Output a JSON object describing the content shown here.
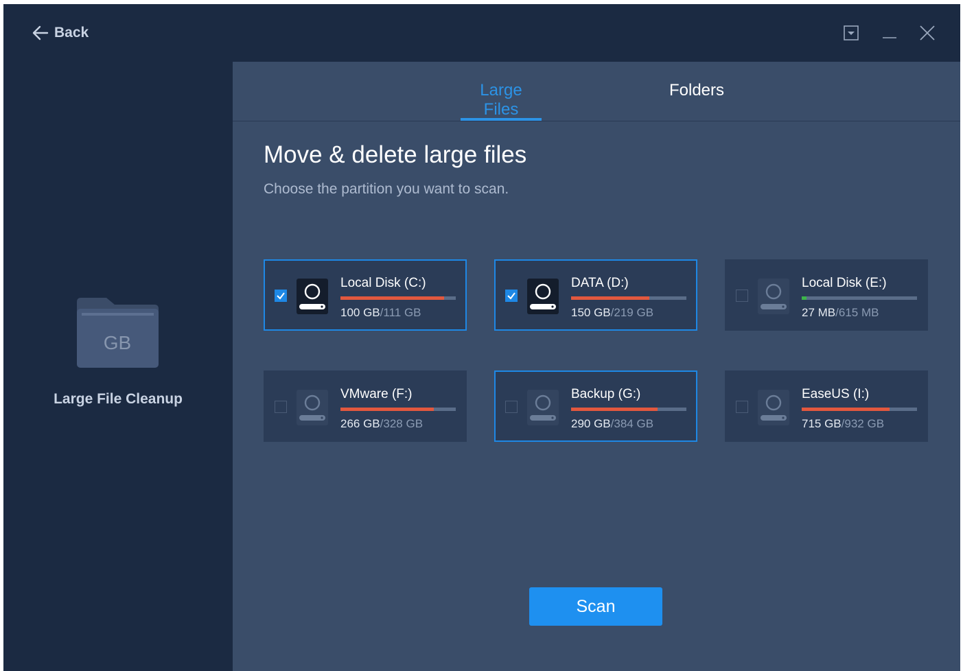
{
  "titlebar": {
    "back_label": "Back"
  },
  "sidebar": {
    "folder_badge": "GB",
    "title": "Large File Cleanup"
  },
  "tabs": [
    {
      "label": "Large Files",
      "active": true
    },
    {
      "label": "Folders",
      "active": false
    }
  ],
  "main": {
    "heading": "Move & delete large files",
    "subheading": "Choose the partition you want to scan."
  },
  "partitions": [
    {
      "name": "Local Disk (C:)",
      "used": "100 GB",
      "total": "/111 GB",
      "usage_fraction": 0.9,
      "checked": true,
      "selected": true,
      "bar_color": "#e2583e"
    },
    {
      "name": "DATA (D:)",
      "used": "150 GB",
      "total": "/219 GB",
      "usage_fraction": 0.68,
      "checked": true,
      "selected": true,
      "bar_color": "#e2583e"
    },
    {
      "name": "Local Disk (E:)",
      "used": "27 MB",
      "total": "/615 MB",
      "usage_fraction": 0.04,
      "checked": false,
      "selected": false,
      "bar_color": "#3cb44b"
    },
    {
      "name": "VMware (F:)",
      "used": "266 GB",
      "total": "/328 GB",
      "usage_fraction": 0.81,
      "checked": false,
      "selected": false,
      "bar_color": "#e2583e"
    },
    {
      "name": "Backup (G:)",
      "used": "290 GB",
      "total": "/384 GB",
      "usage_fraction": 0.75,
      "checked": false,
      "selected": true,
      "bar_color": "#e2583e"
    },
    {
      "name": "EaseUS (I:)",
      "used": "715 GB",
      "total": "/932 GB",
      "usage_fraction": 0.76,
      "checked": false,
      "selected": false,
      "bar_color": "#e2583e"
    }
  ],
  "scan_button": {
    "label": "Scan"
  },
  "colors": {
    "accent": "#1e88e5",
    "tab_active": "#2c93e6",
    "usage_high": "#e2583e",
    "usage_low": "#3cb44b"
  }
}
